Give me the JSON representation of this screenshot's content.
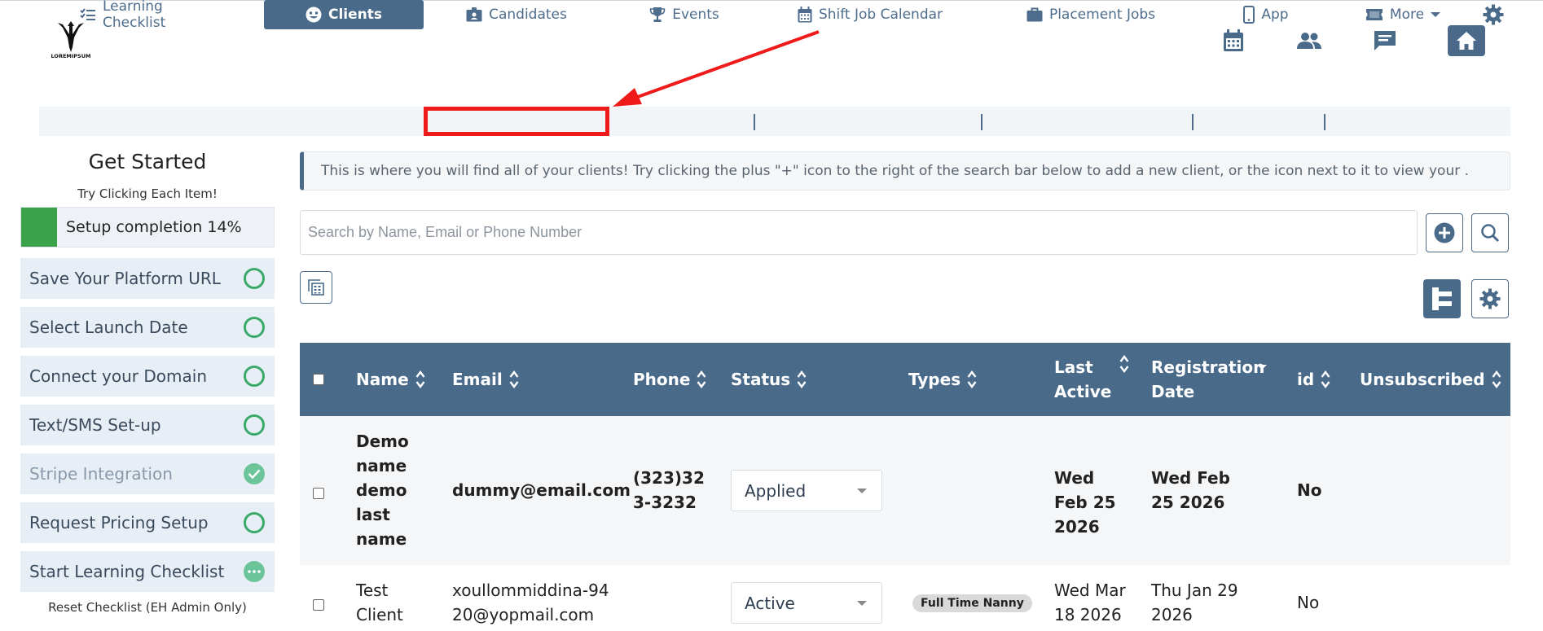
{
  "brand": {
    "logo_text": "LOREMIPSUM"
  },
  "header": {
    "icons": [
      "calendar-icon",
      "people-icon",
      "chat-icon",
      "home-icon"
    ]
  },
  "nav": {
    "items": [
      {
        "label": "Learning Checklist",
        "icon": "checklist-icon"
      },
      {
        "label": "Clients",
        "icon": "smiley-icon",
        "active": true
      },
      {
        "label": "Candidates",
        "icon": "id-badge-icon",
        "highlighted": true
      },
      {
        "label": "Events",
        "icon": "trophy-icon"
      },
      {
        "label": "Shift Job Calendar",
        "icon": "calendar-grid-icon"
      },
      {
        "label": "Placement Jobs",
        "icon": "briefcase-icon"
      },
      {
        "label": "App",
        "icon": "mobile-icon"
      },
      {
        "label": "More",
        "icon": "ticket-icon"
      }
    ],
    "settings_icon": "gear-icon"
  },
  "get_started": {
    "title": "Get Started",
    "subtitle": "Try Clicking Each Item!",
    "progress_label": "Setup completion 14%",
    "progress_percent": 14,
    "items": [
      {
        "label": "Save Your Platform URL",
        "status": "open"
      },
      {
        "label": "Select Launch Date",
        "status": "open"
      },
      {
        "label": "Connect your Domain",
        "status": "open"
      },
      {
        "label": "Text/SMS Set-up",
        "status": "open"
      },
      {
        "label": "Stripe Integration",
        "status": "done"
      },
      {
        "label": "Request Pricing Setup",
        "status": "open"
      },
      {
        "label": "Start Learning Checklist",
        "status": "in-progress"
      }
    ],
    "reset_label": "Reset Checklist (EH Admin Only)"
  },
  "main": {
    "info_text": "This is where you will find all of your clients! Try clicking the plus \"+\" icon to the right of the search bar below to add a new client, or the icon next to it to view your .",
    "search_placeholder": "Search by Name, Email or Phone Number",
    "search_value": ""
  },
  "table": {
    "columns": [
      {
        "label": "Name",
        "sort": "both"
      },
      {
        "label": "Email",
        "sort": "both"
      },
      {
        "label": "Phone",
        "sort": "both"
      },
      {
        "label": "Status",
        "sort": "both"
      },
      {
        "label": "Types",
        "sort": "both"
      },
      {
        "label": "Last Active",
        "sort": "both"
      },
      {
        "label": "Registration Date",
        "sort": "desc"
      },
      {
        "label": "id",
        "sort": "both"
      },
      {
        "label": "Unsubscribed",
        "sort": "both"
      }
    ],
    "rows": [
      {
        "name": "Demo name demo last name",
        "email": "dummy@email.com",
        "phone": "(323)323-3232",
        "status": "Applied",
        "types": "",
        "last_active": "Wed Feb 25 2026",
        "registration_date": "Wed Feb 25 2026",
        "id": "",
        "unsubscribed": "No"
      },
      {
        "name": "Test Client",
        "email": "xoullommiddina-9420@yopmail.com",
        "phone": "",
        "status": "Active",
        "types": "Full Time Nanny",
        "last_active": "Wed Mar 18 2026",
        "registration_date": "Thu Jan 29 2026",
        "id": "",
        "unsubscribed": "No"
      }
    ]
  },
  "colors": {
    "primary": "#4a6a8a",
    "success": "#3aa349",
    "highlight": "#ef1a1a"
  }
}
